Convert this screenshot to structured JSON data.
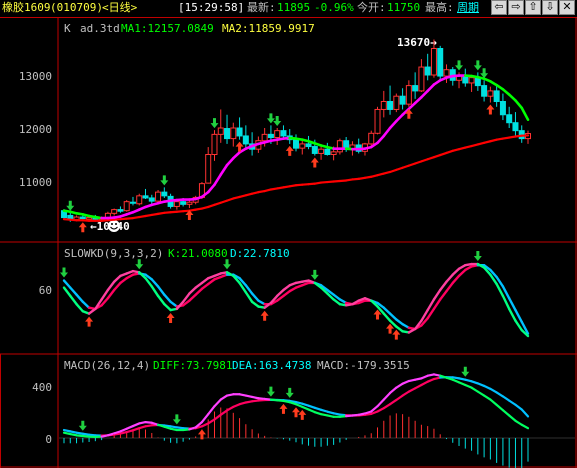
{
  "topbar": {
    "contract": "橡胶1609",
    "code": "(010709)",
    "period": "<日线>",
    "time": "[15:29:58]",
    "last_label": "最新:",
    "last_value": "11895",
    "change": "-0.96%",
    "open_label": "今开:",
    "open_value": "11750",
    "high_label": "最高:",
    "period_link": "周期",
    "nav_buttons": [
      "⇦",
      "⇨",
      "⇧",
      "⇩",
      "✕"
    ]
  },
  "panels": {
    "kline": {
      "symbol": "K",
      "template": "ad.3td",
      "ma1_label": "MA1:12157.0849",
      "ma2_label": "MA2:11859.9917",
      "ticks": [
        "13000",
        "12000",
        "11000"
      ],
      "high_mark": "13670→",
      "low_mark": "←10240"
    },
    "kd": {
      "label": "SLOWKD(9,3,3,2)",
      "k_label": "K:21.0080",
      "d_label": "D:22.7810",
      "ticks": [
        "60"
      ]
    },
    "macd": {
      "label": "MACD(26,12,4)",
      "diff_label": "DIFF:73.7981",
      "dea_label": "DEA:163.4738",
      "macd_label": "MACD:-179.3515",
      "ticks": [
        "400",
        "0"
      ]
    }
  },
  "colors": {
    "background": "#000000",
    "frame": "#c00000",
    "rise": "#ff3232",
    "fall": "#00e0e0",
    "ma1": "#ff00ff",
    "ma1_alt": "#00ff00",
    "ma2": "#ff0000",
    "kd_k": "#00ff80",
    "kd_d": "#ff0060",
    "last": "#00ff00",
    "text": "#c0c0c0",
    "link": "#00ffff"
  },
  "chart_data": {
    "type": "candlestick",
    "candles": [
      [
        10440,
        10470,
        10290,
        10310
      ],
      [
        10350,
        10400,
        10230,
        10270
      ],
      [
        10270,
        10350,
        10240,
        10320
      ],
      [
        10320,
        10380,
        10260,
        10290
      ],
      [
        10280,
        10340,
        10240,
        10310
      ],
      [
        10310,
        10360,
        10250,
        10280
      ],
      [
        10270,
        10330,
        10240,
        10300
      ],
      [
        10300,
        10420,
        10270,
        10390
      ],
      [
        10390,
        10480,
        10350,
        10460
      ],
      [
        10460,
        10520,
        10400,
        10430
      ],
      [
        10440,
        10640,
        10420,
        10610
      ],
      [
        10600,
        10700,
        10540,
        10580
      ],
      [
        10570,
        10760,
        10540,
        10720
      ],
      [
        10720,
        10850,
        10660,
        10680
      ],
      [
        10680,
        10740,
        10560,
        10620
      ],
      [
        10620,
        10830,
        10590,
        10790
      ],
      [
        10790,
        10880,
        10680,
        10720
      ],
      [
        10710,
        10760,
        10480,
        10520
      ],
      [
        10520,
        10640,
        10460,
        10610
      ],
      [
        10610,
        10680,
        10520,
        10560
      ],
      [
        10560,
        10640,
        10490,
        10600
      ],
      [
        10600,
        10720,
        10560,
        10690
      ],
      [
        10690,
        10980,
        10660,
        10950
      ],
      [
        10960,
        11640,
        10950,
        11500
      ],
      [
        11500,
        11960,
        11380,
        11880
      ],
      [
        11880,
        12350,
        11720,
        12000
      ],
      [
        11990,
        12250,
        11700,
        11800
      ],
      [
        11800,
        12100,
        11650,
        12000
      ],
      [
        12000,
        12200,
        11780,
        11850
      ],
      [
        11850,
        12050,
        11600,
        11700
      ],
      [
        11700,
        11920,
        11480,
        11600
      ],
      [
        11600,
        11840,
        11530,
        11760
      ],
      [
        11760,
        12000,
        11650,
        11880
      ],
      [
        11880,
        12050,
        11700,
        11820
      ],
      [
        11820,
        12000,
        11680,
        11950
      ],
      [
        11950,
        12050,
        11800,
        11850
      ],
      [
        11850,
        11980,
        11700,
        11780
      ],
      [
        11780,
        11880,
        11560,
        11620
      ],
      [
        11620,
        11770,
        11500,
        11700
      ],
      [
        11700,
        11850,
        11600,
        11650
      ],
      [
        11650,
        11780,
        11480,
        11520
      ],
      [
        11520,
        11650,
        11400,
        11600
      ],
      [
        11600,
        11720,
        11480,
        11500
      ],
      [
        11500,
        11650,
        11390,
        11550
      ],
      [
        11550,
        11800,
        11500,
        11760
      ],
      [
        11760,
        11830,
        11550,
        11600
      ],
      [
        11600,
        11750,
        11480,
        11680
      ],
      [
        11680,
        11800,
        11520,
        11560
      ],
      [
        11560,
        11720,
        11480,
        11700
      ],
      [
        11700,
        11950,
        11660,
        11900
      ],
      [
        11900,
        12400,
        11880,
        12350
      ],
      [
        12350,
        12700,
        12200,
        12500
      ],
      [
        12500,
        12800,
        12250,
        12350
      ],
      [
        12350,
        12650,
        12300,
        12600
      ],
      [
        12600,
        12750,
        12350,
        12450
      ],
      [
        12450,
        12900,
        12400,
        12800
      ],
      [
        12800,
        13050,
        12550,
        12700
      ],
      [
        12700,
        13300,
        12680,
        13150
      ],
      [
        13150,
        13400,
        12900,
        13000
      ],
      [
        13000,
        13670,
        12950,
        13500
      ],
      [
        13500,
        13550,
        12900,
        12980
      ],
      [
        12980,
        13200,
        12850,
        13100
      ],
      [
        13100,
        13150,
        12800,
        12900
      ],
      [
        12900,
        13050,
        12750,
        13000
      ],
      [
        13000,
        13120,
        12780,
        12850
      ],
      [
        12850,
        13000,
        12680,
        12950
      ],
      [
        12950,
        13050,
        12700,
        12800
      ],
      [
        12800,
        12900,
        12500,
        12600
      ],
      [
        12600,
        12780,
        12480,
        12700
      ],
      [
        12700,
        12800,
        12400,
        12500
      ],
      [
        12500,
        12650,
        12150,
        12250
      ],
      [
        12250,
        12400,
        12000,
        12100
      ],
      [
        12100,
        12300,
        11850,
        11950
      ],
      [
        11950,
        12050,
        11720,
        11800
      ],
      [
        11800,
        11950,
        11700,
        11895
      ]
    ],
    "ma1": [
      10440,
      10420,
      10390,
      10370,
      10340,
      10320,
      10300,
      10300,
      10310,
      10330,
      10370,
      10410,
      10460,
      10510,
      10550,
      10580,
      10610,
      10630,
      10640,
      10650,
      10650,
      10660,
      10700,
      10790,
      10930,
      11120,
      11300,
      11430,
      11540,
      11610,
      11660,
      11700,
      11730,
      11760,
      11780,
      11800,
      11810,
      11800,
      11780,
      11750,
      11710,
      11670,
      11640,
      11610,
      11610,
      11610,
      11600,
      11600,
      11610,
      11640,
      11720,
      11850,
      12000,
      12130,
      12250,
      12360,
      12470,
      12580,
      12700,
      12820,
      12900,
      12950,
      12980,
      12990,
      12990,
      12980,
      12960,
      12930,
      12880,
      12810,
      12730,
      12630,
      12520,
      12380,
      12157
    ],
    "ma2": [
      10280,
      10270,
      10260,
      10260,
      10250,
      10250,
      10250,
      10260,
      10270,
      10280,
      10290,
      10300,
      10320,
      10340,
      10360,
      10380,
      10400,
      10410,
      10420,
      10430,
      10440,
      10460,
      10480,
      10510,
      10550,
      10590,
      10630,
      10670,
      10700,
      10730,
      10760,
      10790,
      10810,
      10840,
      10860,
      10880,
      10900,
      10920,
      10930,
      10940,
      10950,
      10970,
      10980,
      10990,
      11000,
      11010,
      11030,
      11040,
      11060,
      11080,
      11110,
      11140,
      11170,
      11210,
      11250,
      11290,
      11330,
      11370,
      11410,
      11450,
      11490,
      11530,
      11570,
      11600,
      11630,
      11660,
      11690,
      11720,
      11750,
      11780,
      11800,
      11820,
      11840,
      11855,
      11860
    ],
    "kd_k": [
      62,
      55,
      48,
      42,
      40,
      44,
      52,
      60,
      67,
      72,
      74,
      76,
      75,
      70,
      63,
      55,
      48,
      43,
      44,
      50,
      57,
      62,
      66,
      70,
      72,
      74,
      75,
      72,
      66,
      58,
      50,
      46,
      45,
      49,
      55,
      60,
      64,
      66,
      67,
      68,
      66,
      62,
      57,
      52,
      48,
      47,
      48,
      51,
      53,
      51,
      46,
      40,
      34,
      29,
      25,
      24,
      27,
      34,
      43,
      52,
      60,
      67,
      73,
      78,
      81,
      82,
      82,
      79,
      73,
      65,
      55,
      44,
      34,
      26,
      21
    ],
    "kd_d": [
      68,
      62,
      56,
      50,
      45,
      44,
      47,
      53,
      60,
      66,
      70,
      73,
      74,
      73,
      69,
      63,
      56,
      50,
      46,
      47,
      51,
      56,
      61,
      65,
      69,
      71,
      73,
      73,
      70,
      64,
      57,
      51,
      48,
      48,
      51,
      55,
      59,
      62,
      64,
      66,
      66,
      64,
      60,
      56,
      52,
      49,
      48,
      49,
      51,
      51,
      49,
      45,
      40,
      35,
      31,
      28,
      27,
      30,
      36,
      44,
      52,
      59,
      66,
      72,
      77,
      80,
      81,
      81,
      77,
      71,
      63,
      53,
      43,
      33,
      23
    ],
    "diff": [
      40,
      30,
      20,
      15,
      10,
      8,
      10,
      20,
      35,
      50,
      70,
      90,
      110,
      120,
      115,
      100,
      85,
      70,
      60,
      60,
      65,
      80,
      120,
      180,
      240,
      290,
      320,
      330,
      330,
      320,
      310,
      300,
      295,
      290,
      285,
      280,
      270,
      255,
      235,
      215,
      195,
      180,
      170,
      160,
      160,
      165,
      170,
      175,
      185,
      200,
      240,
      290,
      340,
      380,
      410,
      430,
      440,
      450,
      470,
      480,
      470,
      455,
      440,
      420,
      400,
      380,
      350,
      320,
      290,
      250,
      210,
      170,
      130,
      100,
      74
    ],
    "dea": [
      60,
      50,
      40,
      32,
      25,
      20,
      18,
      20,
      26,
      34,
      45,
      58,
      74,
      88,
      96,
      98,
      95,
      88,
      80,
      74,
      71,
      74,
      88,
      110,
      140,
      175,
      208,
      235,
      255,
      268,
      277,
      283,
      287,
      288,
      287,
      285,
      280,
      271,
      259,
      244,
      228,
      213,
      199,
      186,
      177,
      172,
      170,
      171,
      175,
      182,
      200,
      225,
      255,
      287,
      320,
      350,
      375,
      400,
      425,
      445,
      456,
      459,
      458,
      450,
      440,
      428,
      412,
      393,
      371,
      344,
      314,
      282,
      251,
      215,
      163
    ]
  }
}
